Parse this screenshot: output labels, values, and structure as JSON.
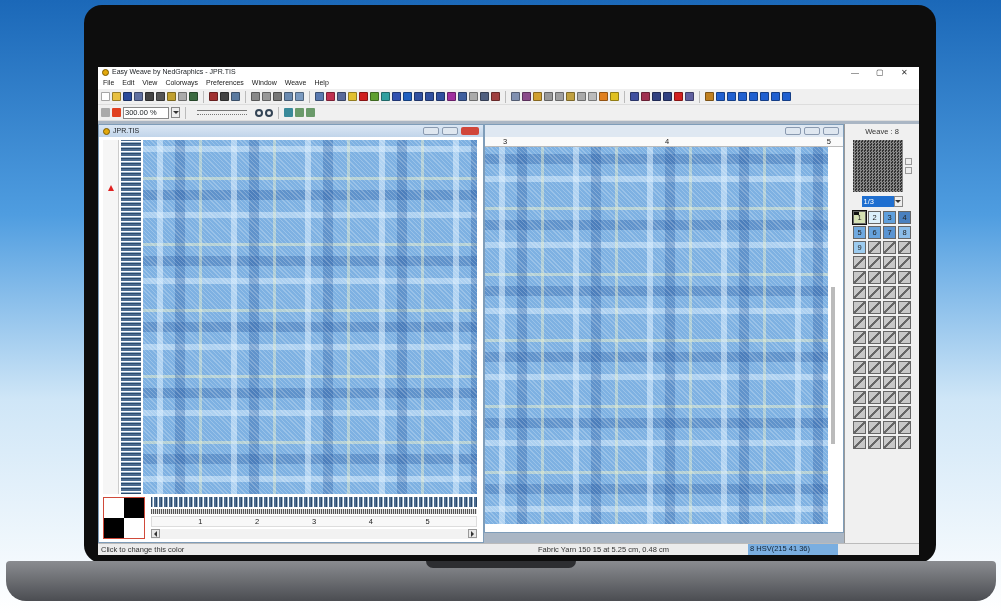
{
  "window": {
    "title": "Easy Weave by NedGraphics - JPR.TIS",
    "controls": [
      "—",
      "▢",
      "✕"
    ]
  },
  "menu": [
    "File",
    "Edit",
    "View",
    "Colorways",
    "Preferences",
    "Window",
    "Weave",
    "Help"
  ],
  "zoom_field": {
    "value": "300.00 %"
  },
  "left_window": {
    "title": "JPR.TIS",
    "ruler_labels": [
      "1",
      "2",
      "3",
      "4",
      "5"
    ]
  },
  "right_window": {
    "ruler_labels": [
      "3",
      "4",
      "5"
    ]
  },
  "weave_panel": {
    "title": "Weave : 8",
    "repeat": "1/3",
    "swatches": [
      {
        "kind": "color",
        "label": "1",
        "color": "#d6e2b4",
        "selected": true
      },
      {
        "kind": "color",
        "label": "2",
        "color": "#dcefFa",
        "selected": false
      },
      {
        "kind": "color",
        "label": "3",
        "color": "#5f9fdc",
        "selected": false
      },
      {
        "kind": "color",
        "label": "4",
        "color": "#4a80bf",
        "selected": false
      },
      {
        "kind": "color",
        "label": "5",
        "color": "#6fa9e0",
        "selected": false
      },
      {
        "kind": "color",
        "label": "6",
        "color": "#66a2dc",
        "selected": false
      },
      {
        "kind": "color",
        "label": "7",
        "color": "#5a94d2",
        "selected": false
      },
      {
        "kind": "color",
        "label": "8",
        "color": "#8cbde9",
        "selected": false
      },
      {
        "kind": "color",
        "label": "9",
        "color": "#9ccbef",
        "selected": false
      },
      {
        "kind": "empty"
      },
      {
        "kind": "empty"
      },
      {
        "kind": "empty"
      },
      {
        "kind": "empty"
      },
      {
        "kind": "empty"
      },
      {
        "kind": "empty"
      },
      {
        "kind": "empty"
      },
      {
        "kind": "empty"
      },
      {
        "kind": "empty"
      },
      {
        "kind": "empty"
      },
      {
        "kind": "empty"
      },
      {
        "kind": "empty"
      },
      {
        "kind": "empty"
      },
      {
        "kind": "empty"
      },
      {
        "kind": "empty"
      },
      {
        "kind": "empty"
      },
      {
        "kind": "empty"
      },
      {
        "kind": "empty"
      },
      {
        "kind": "empty"
      },
      {
        "kind": "empty"
      },
      {
        "kind": "empty"
      },
      {
        "kind": "empty"
      },
      {
        "kind": "empty"
      },
      {
        "kind": "empty"
      },
      {
        "kind": "empty"
      },
      {
        "kind": "empty"
      },
      {
        "kind": "empty"
      },
      {
        "kind": "empty"
      },
      {
        "kind": "empty"
      },
      {
        "kind": "empty"
      },
      {
        "kind": "empty"
      },
      {
        "kind": "empty"
      },
      {
        "kind": "empty"
      },
      {
        "kind": "empty"
      },
      {
        "kind": "empty"
      },
      {
        "kind": "empty"
      },
      {
        "kind": "empty"
      },
      {
        "kind": "empty"
      },
      {
        "kind": "empty"
      },
      {
        "kind": "empty"
      },
      {
        "kind": "empty"
      },
      {
        "kind": "empty"
      },
      {
        "kind": "empty"
      },
      {
        "kind": "empty"
      },
      {
        "kind": "empty"
      },
      {
        "kind": "empty"
      },
      {
        "kind": "empty"
      },
      {
        "kind": "empty"
      },
      {
        "kind": "empty"
      },
      {
        "kind": "empty"
      },
      {
        "kind": "empty"
      },
      {
        "kind": "empty"
      },
      {
        "kind": "empty"
      },
      {
        "kind": "empty"
      },
      {
        "kind": "empty"
      }
    ]
  },
  "status_bar": {
    "hint": "Click to change this color",
    "yarn": "Fabric Yarn  150  15  at  5.25 cm, 0.48 cm",
    "color_value": "8 HSV(215 41 36)"
  }
}
